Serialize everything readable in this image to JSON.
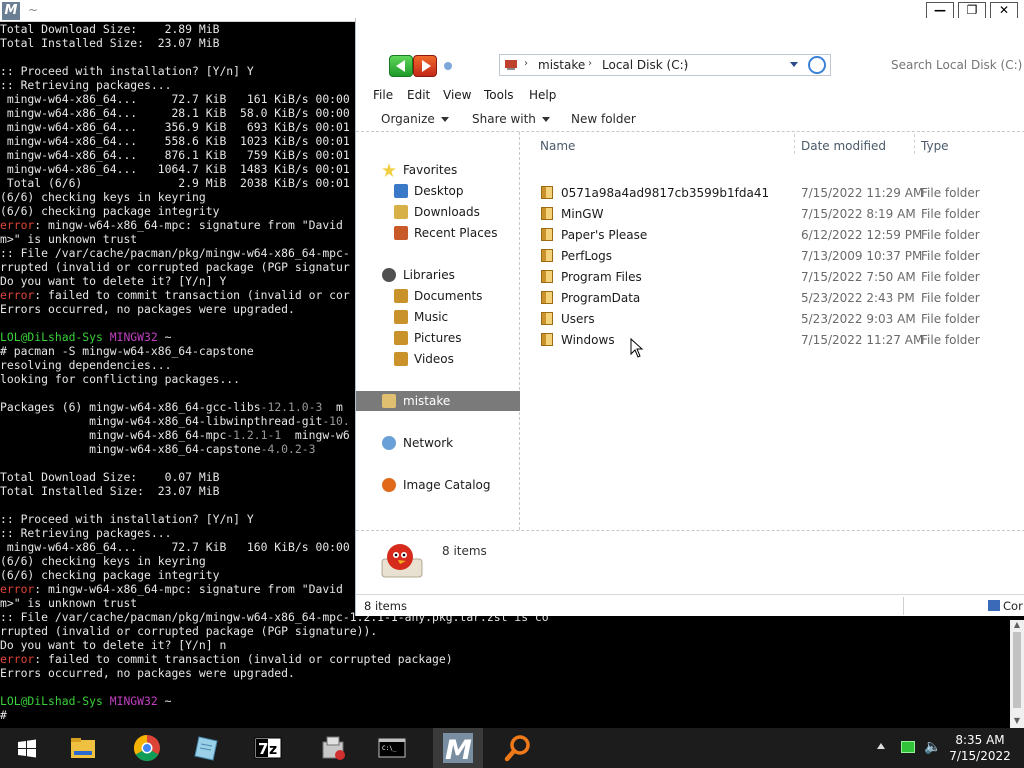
{
  "terminal": {
    "title": "~",
    "lines": [
      [
        [
          "Total Download Size:    2.89 MiB",
          ""
        ]
      ],
      [
        [
          "Total Installed Size:  23.07 MiB",
          ""
        ]
      ],
      [
        [
          "",
          ""
        ]
      ],
      [
        [
          ":: Proceed with installation? [Y/n] Y",
          ""
        ]
      ],
      [
        [
          ":: Retrieving packages...",
          ""
        ]
      ],
      [
        [
          " mingw-w64-x86_64...     72.7 KiB   161 KiB/s 00:00",
          ""
        ]
      ],
      [
        [
          " mingw-w64-x86_64...     28.1 KiB  58.0 KiB/s 00:00",
          ""
        ]
      ],
      [
        [
          " mingw-w64-x86_64...    356.9 KiB   693 KiB/s 00:01",
          ""
        ]
      ],
      [
        [
          " mingw-w64-x86_64...    558.6 KiB  1023 KiB/s 00:01",
          ""
        ]
      ],
      [
        [
          " mingw-w64-x86_64...    876.1 KiB   759 KiB/s 00:01",
          ""
        ]
      ],
      [
        [
          " mingw-w64-x86_64...   1064.7 KiB  1483 KiB/s 00:01",
          ""
        ]
      ],
      [
        [
          " Total (6/6)              2.9 MiB  2038 KiB/s 00:01",
          ""
        ]
      ],
      [
        [
          "(6/6) checking keys in keyring",
          ""
        ]
      ],
      [
        [
          "(6/6) checking package integrity",
          ""
        ]
      ],
      [
        [
          "error",
          "red"
        ],
        [
          ": mingw-w64-x86_64-mpc: signature from \"David",
          ""
        ]
      ],
      [
        [
          "m>\" is unknown trust",
          ""
        ]
      ],
      [
        [
          ":: File /var/cache/pacman/pkg/mingw-w64-x86_64-mpc-",
          ""
        ]
      ],
      [
        [
          "rrupted (invalid or corrupted package (PGP signatur",
          ""
        ]
      ],
      [
        [
          "Do you want to delete it? [Y/n] Y",
          ""
        ]
      ],
      [
        [
          "error",
          "red"
        ],
        [
          ": failed to commit transaction (invalid or cor",
          ""
        ]
      ],
      [
        [
          "Errors occurred, no packages were upgraded.",
          ""
        ]
      ],
      [
        [
          "",
          ""
        ]
      ],
      [
        [
          "LOL@DiLshad-Sys ",
          "green"
        ],
        [
          "MINGW32",
          "mag"
        ],
        [
          " ~",
          ""
        ]
      ],
      [
        [
          "# pacman -S mingw-w64-x86_64-capstone",
          ""
        ]
      ],
      [
        [
          "resolving dependencies...",
          ""
        ]
      ],
      [
        [
          "looking for conflicting packages...",
          ""
        ]
      ],
      [
        [
          "",
          ""
        ]
      ],
      [
        [
          "Packages (6) mingw-w64-x86_64-gcc-libs",
          ""
        ],
        [
          "-12.1.0-3",
          "ver"
        ],
        [
          "  m",
          ""
        ]
      ],
      [
        [
          "             mingw-w64-x86_64-libwinpthread-git",
          ""
        ],
        [
          "-10.",
          "ver"
        ]
      ],
      [
        [
          "             mingw-w64-x86_64-mpc",
          ""
        ],
        [
          "-1.2.1-1",
          "ver"
        ],
        [
          "  mingw-w6",
          ""
        ]
      ],
      [
        [
          "             mingw-w64-x86_64-capstone",
          ""
        ],
        [
          "-4.0.2-3",
          "ver"
        ]
      ],
      [
        [
          "",
          ""
        ]
      ],
      [
        [
          "Total Download Size:    0.07 MiB",
          ""
        ]
      ],
      [
        [
          "Total Installed Size:  23.07 MiB",
          ""
        ]
      ],
      [
        [
          "",
          ""
        ]
      ],
      [
        [
          ":: Proceed with installation? [Y/n] Y",
          ""
        ]
      ],
      [
        [
          ":: Retrieving packages...",
          ""
        ]
      ],
      [
        [
          " mingw-w64-x86_64...     72.7 KiB   160 KiB/s 00:00",
          ""
        ]
      ],
      [
        [
          "(6/6) checking keys in keyring",
          ""
        ]
      ],
      [
        [
          "(6/6) checking package integrity",
          ""
        ]
      ],
      [
        [
          "error",
          "red"
        ],
        [
          ": mingw-w64-x86_64-mpc: signature from \"David",
          ""
        ]
      ],
      [
        [
          "m>\" is unknown trust",
          ""
        ]
      ],
      [
        [
          ":: File /var/cache/pacman/pkg/mingw-w64-x86_64-mpc-1.2.1-1-any.pkg.tar.zst is co",
          ""
        ]
      ],
      [
        [
          "rrupted (invalid or corrupted package (PGP signature)).",
          ""
        ]
      ],
      [
        [
          "Do you want to delete it? [Y/n] n",
          ""
        ]
      ],
      [
        [
          "error",
          "red"
        ],
        [
          ": failed to commit transaction (invalid or corrupted package)",
          ""
        ]
      ],
      [
        [
          "Errors occurred, no packages were upgraded.",
          ""
        ]
      ],
      [
        [
          "",
          ""
        ]
      ],
      [
        [
          "LOL@DiLshad-Sys ",
          "green"
        ],
        [
          "MINGW32",
          "mag"
        ],
        [
          " ~",
          ""
        ]
      ],
      [
        [
          "# ",
          ""
        ]
      ]
    ]
  },
  "explorer": {
    "breadcrumb": [
      "mistake",
      "Local Disk (C:)"
    ],
    "search_placeholder": "Search Local Disk (C:)",
    "menu": [
      "File",
      "Edit",
      "View",
      "Tools",
      "Help"
    ],
    "commands": {
      "organize": "Organize",
      "share_with": "Share with",
      "new_folder": "New folder"
    },
    "nav": {
      "favorites": "Favorites",
      "desktop": "Desktop",
      "downloads": "Downloads",
      "recent_places": "Recent Places",
      "libraries": "Libraries",
      "documents": "Documents",
      "music": "Music",
      "pictures": "Pictures",
      "videos": "Videos",
      "mistake": "mistake",
      "network": "Network",
      "image_catalog": "Image Catalog"
    },
    "columns": {
      "name": "Name",
      "date": "Date modified",
      "type": "Type"
    },
    "files": [
      {
        "name": "0571a98a4ad9817cb3599b1fda41",
        "date": "7/15/2022 11:29 AM",
        "type": "File folder"
      },
      {
        "name": "MinGW",
        "date": "7/15/2022 8:19 AM",
        "type": "File folder"
      },
      {
        "name": "Paper's Please",
        "date": "6/12/2022 12:59 PM",
        "type": "File folder"
      },
      {
        "name": "PerfLogs",
        "date": "7/13/2009 10:37 PM",
        "type": "File folder"
      },
      {
        "name": "Program Files",
        "date": "7/15/2022 7:50 AM",
        "type": "File folder"
      },
      {
        "name": "ProgramData",
        "date": "5/23/2022 2:43 PM",
        "type": "File folder"
      },
      {
        "name": "Users",
        "date": "5/23/2022 9:03 AM",
        "type": "File folder"
      },
      {
        "name": "Windows",
        "date": "7/15/2022 11:27 AM",
        "type": "File folder"
      }
    ],
    "details_count": "8 items",
    "status_count": "8 items",
    "status_computer": "Cor"
  },
  "taskbar": {
    "time": "8:35 AM",
    "date": "7/15/2022",
    "apps": [
      "windows-start-icon",
      "file-explorer-icon",
      "chrome-icon",
      "notepad-icon",
      "7zip-icon",
      "installer-icon",
      "cmd-icon",
      "msys2-icon",
      "search-tool-icon"
    ]
  },
  "colors": {
    "error": "#e0453a",
    "prompt_user": "#3ad13a",
    "prompt_env": "#c040c0",
    "selected_nav": "#7a7a7a",
    "taskbar": "#1c1c1c"
  }
}
